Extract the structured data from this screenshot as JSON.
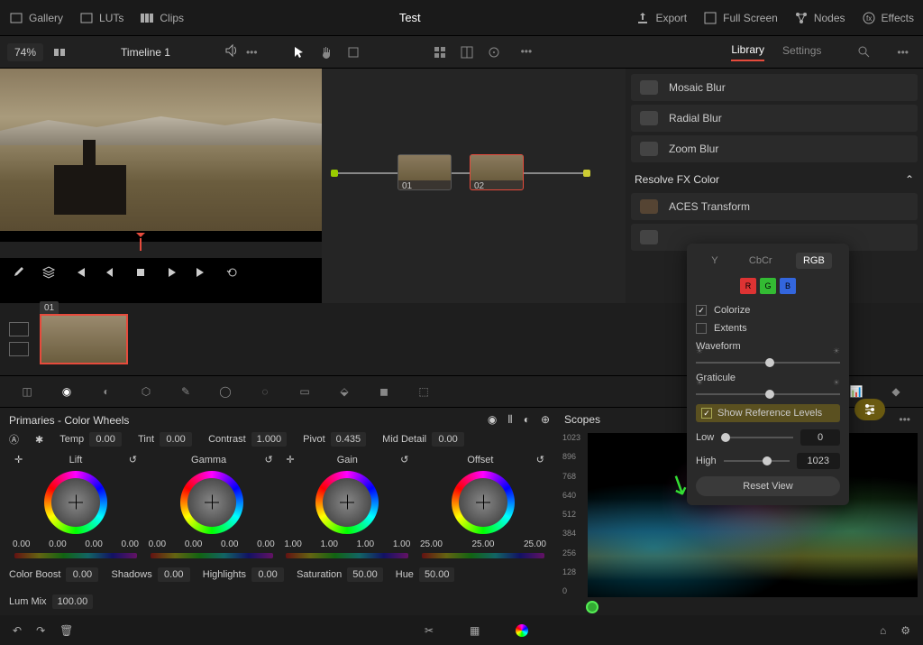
{
  "topbar": {
    "gallery": "Gallery",
    "luts": "LUTs",
    "clips": "Clips",
    "title": "Test",
    "export": "Export",
    "fullscreen": "Full Screen",
    "nodes": "Nodes",
    "effects": "Effects"
  },
  "secondrow": {
    "zoom": "74%",
    "timeline": "Timeline 1"
  },
  "library": {
    "tab_library": "Library",
    "tab_settings": "Settings",
    "items": [
      "Mosaic Blur",
      "Radial Blur",
      "Zoom Blur"
    ],
    "section": "Resolve FX Color",
    "aces": "ACES Transform"
  },
  "nodes": {
    "n1": "01",
    "n2": "02"
  },
  "clip": {
    "badge": "01"
  },
  "primaries": {
    "title": "Primaries - Color Wheels",
    "temp": "Temp",
    "temp_v": "0.00",
    "tint": "Tint",
    "tint_v": "0.00",
    "contrast": "Contrast",
    "contrast_v": "1.000",
    "pivot": "Pivot",
    "pivot_v": "0.435",
    "middetail": "Mid Detail",
    "middetail_v": "0.00",
    "wheels": {
      "lift": {
        "name": "Lift",
        "vals": [
          "0.00",
          "0.00",
          "0.00",
          "0.00"
        ]
      },
      "gamma": {
        "name": "Gamma",
        "vals": [
          "0.00",
          "0.00",
          "0.00",
          "0.00"
        ]
      },
      "gain": {
        "name": "Gain",
        "vals": [
          "1.00",
          "1.00",
          "1.00",
          "1.00"
        ]
      },
      "offset": {
        "name": "Offset",
        "vals": [
          "25.00",
          "25.00",
          "25.00"
        ]
      }
    },
    "colorboost": "Color Boost",
    "colorboost_v": "0.00",
    "shadows": "Shadows",
    "shadows_v": "0.00",
    "highlights": "Highlights",
    "highlights_v": "0.00",
    "saturation": "Saturation",
    "saturation_v": "50.00",
    "hue": "Hue",
    "hue_v": "50.00",
    "lummix": "Lum Mix",
    "lummix_v": "100.00"
  },
  "scopes": {
    "title": "Scopes",
    "levels": [
      "1023",
      "896",
      "768",
      "640",
      "512",
      "384",
      "256",
      "128",
      "0"
    ]
  },
  "popup": {
    "tabs": {
      "y": "Y",
      "cbcr": "CbCr",
      "rgb": "RGB"
    },
    "rgb": {
      "r": "R",
      "g": "G",
      "b": "B"
    },
    "colorize": "Colorize",
    "extents": "Extents",
    "waveform": "Waveform",
    "graticule": "Graticule",
    "show_ref": "Show Reference Levels",
    "low": "Low",
    "low_v": "0",
    "high": "High",
    "high_v": "1023",
    "reset": "Reset View"
  }
}
